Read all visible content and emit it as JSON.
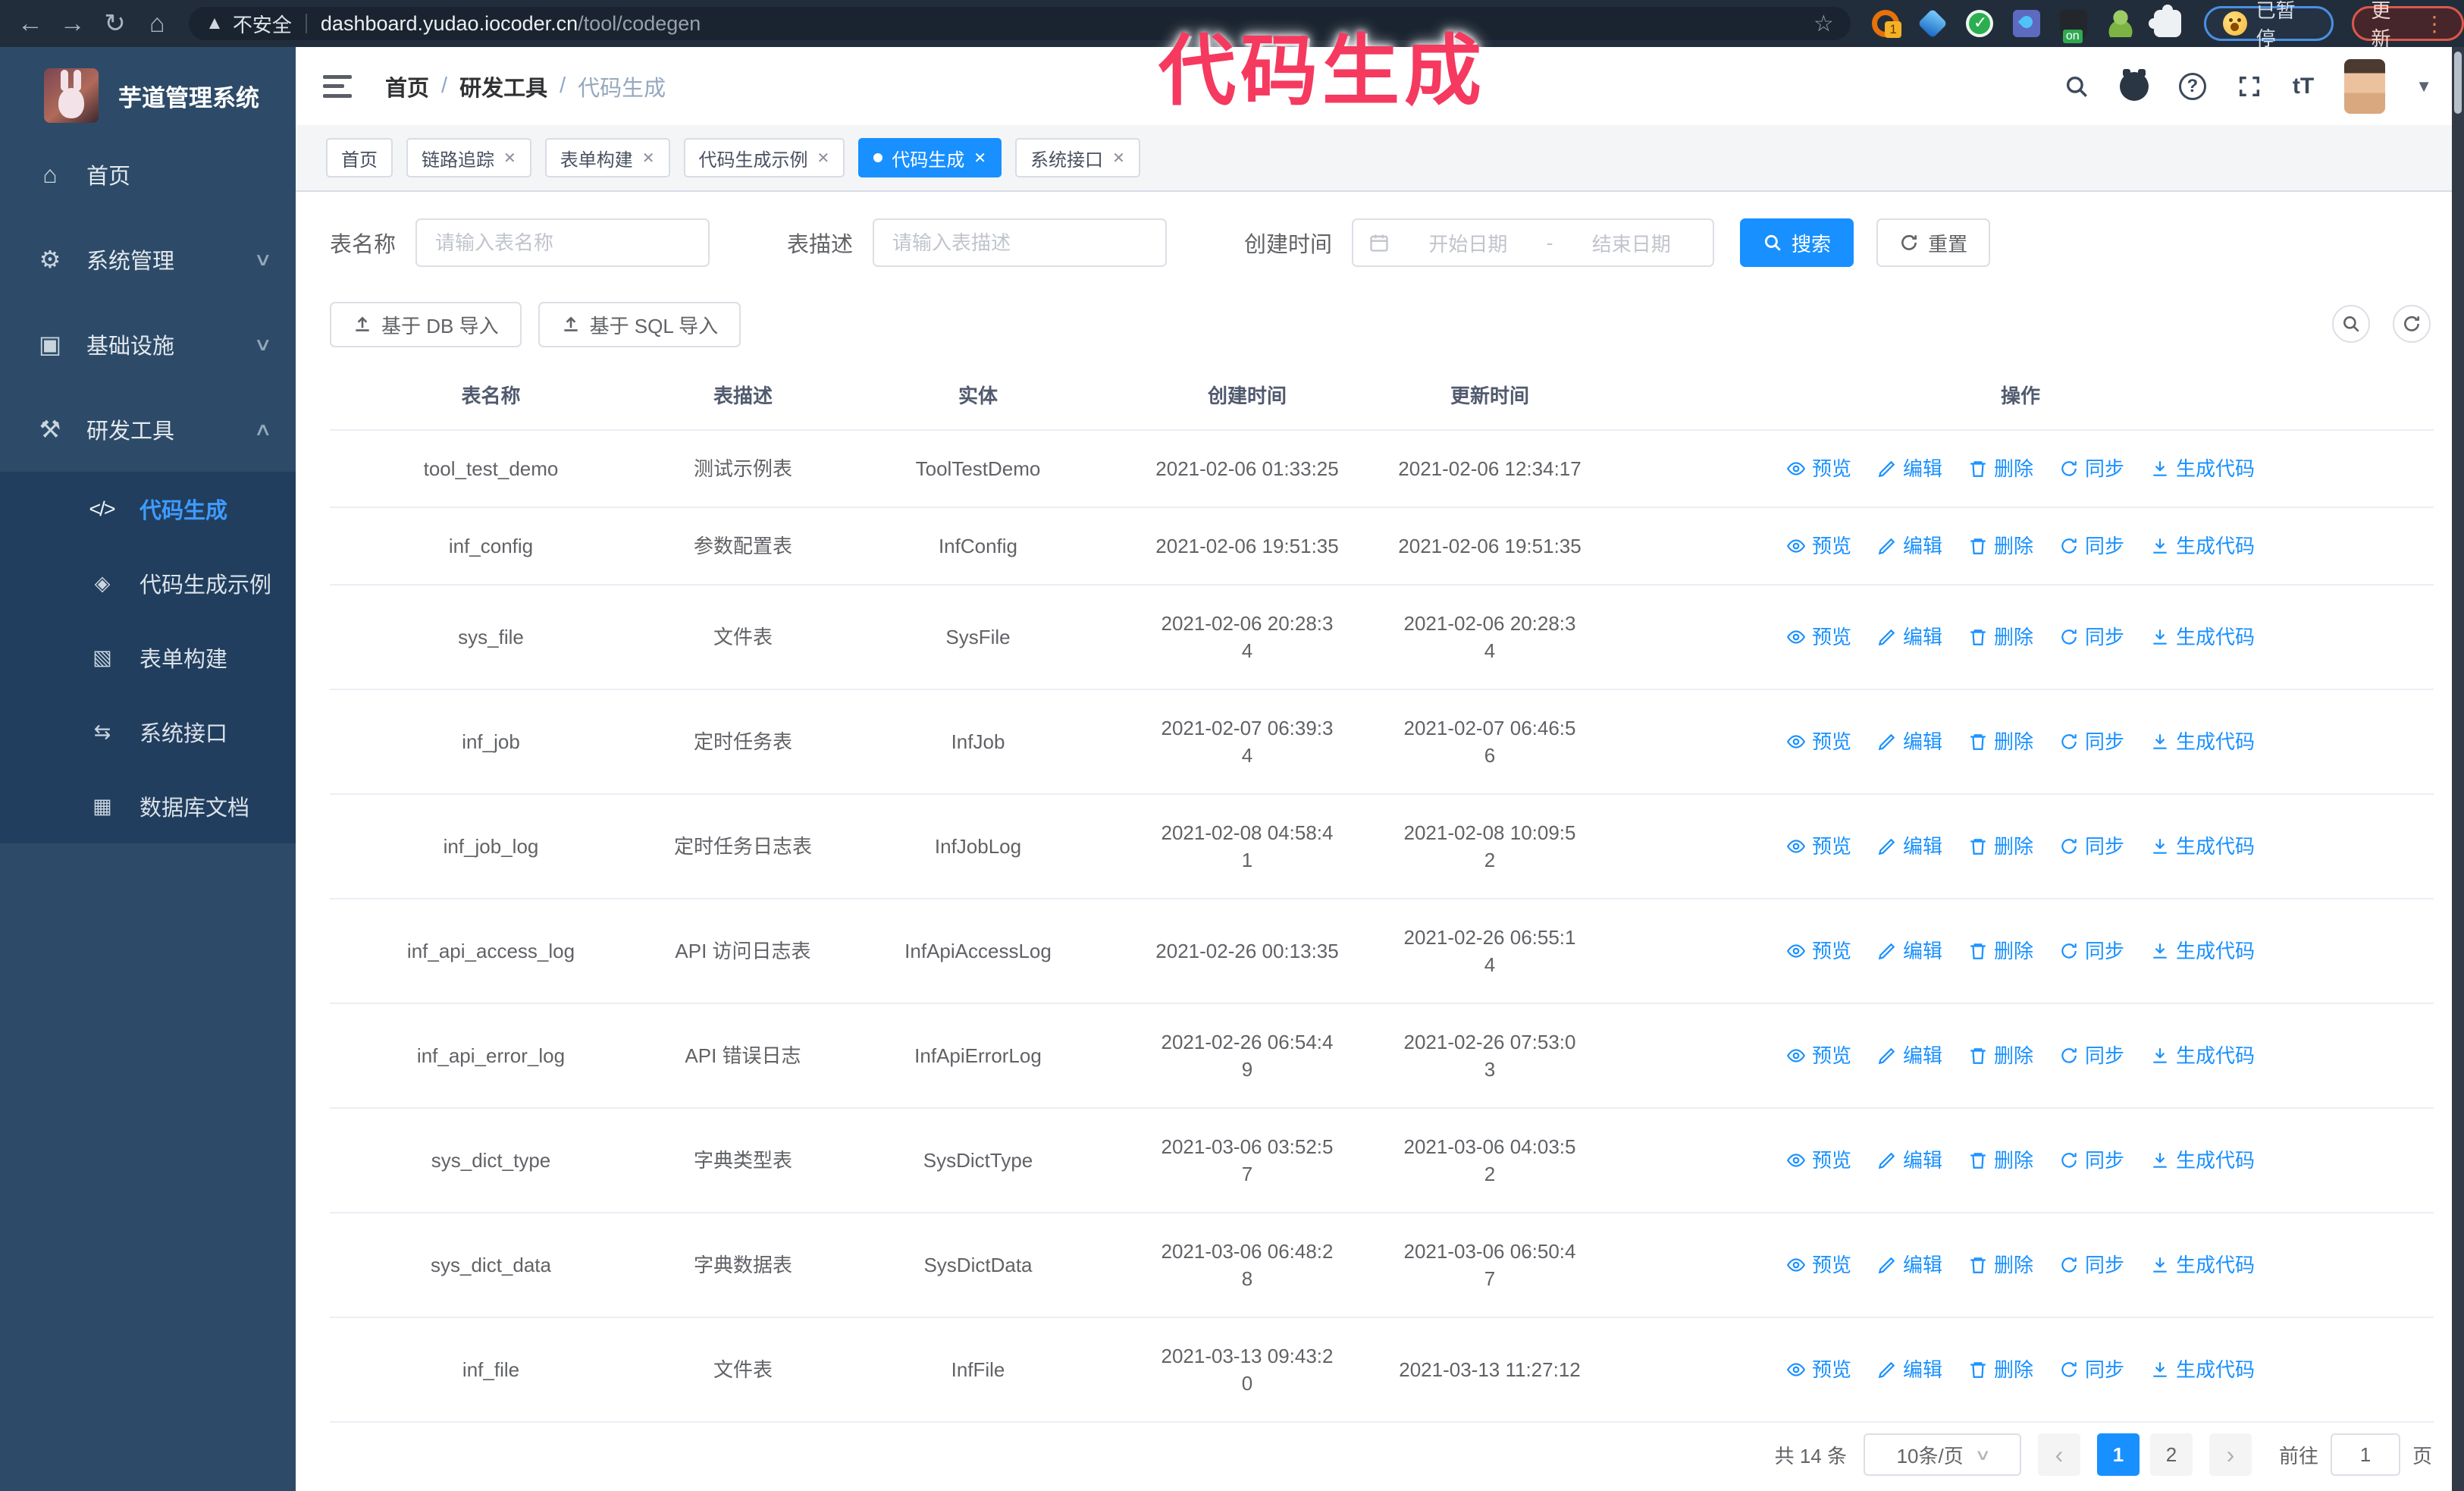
{
  "colors": {
    "accent": "#1890ff",
    "active-link": "#3f9bff",
    "annotation": "#f5395f",
    "topbar-bg": "#222d3b",
    "sidebar-bg": "#2d4b68",
    "submenu-bg": "#213e5e"
  },
  "annotation": {
    "text": "代码生成"
  },
  "browser": {
    "insecure_label": "不安全",
    "url_host": "dashboard.yudao.iocoder.cn",
    "url_path": "/tool/codegen",
    "paused_badge": "已暂停",
    "update_badge": "更新",
    "extensions": [
      "refresh-orange-icon",
      "gem-icon",
      "check-shield-icon",
      "tabs-droplet-icon",
      "recorder-on-icon",
      "person-icon",
      "puzzle-icon"
    ]
  },
  "sidebar": {
    "app_title": "芋道管理系统",
    "items": [
      {
        "label": "首页",
        "icon": "home-icon",
        "chevron": ""
      },
      {
        "label": "系统管理",
        "icon": "gear-icon",
        "chevron": "down"
      },
      {
        "label": "基础设施",
        "icon": "infra-icon",
        "chevron": "down"
      },
      {
        "label": "研发工具",
        "icon": "toolbox-icon",
        "chevron": "up"
      }
    ],
    "submenu": [
      {
        "label": "代码生成",
        "icon": "code-icon",
        "active": true
      },
      {
        "label": "代码生成示例",
        "icon": "example-icon",
        "active": false
      },
      {
        "label": "表单构建",
        "icon": "form-icon",
        "active": false
      },
      {
        "label": "系统接口",
        "icon": "api-icon",
        "active": false
      },
      {
        "label": "数据库文档",
        "icon": "dbdoc-icon",
        "active": false
      }
    ]
  },
  "header": {
    "breadcrumb": [
      "首页",
      "研发工具",
      "代码生成"
    ]
  },
  "tabs": [
    {
      "label": "首页",
      "closable": false,
      "active": false
    },
    {
      "label": "链路追踪",
      "closable": true,
      "active": false
    },
    {
      "label": "表单构建",
      "closable": true,
      "active": false
    },
    {
      "label": "代码生成示例",
      "closable": true,
      "active": false
    },
    {
      "label": "代码生成",
      "closable": true,
      "active": true
    },
    {
      "label": "系统接口",
      "closable": true,
      "active": false
    }
  ],
  "filters": {
    "name_label": "表名称",
    "name_placeholder": "请输入表名称",
    "desc_label": "表描述",
    "desc_placeholder": "请输入表描述",
    "time_label": "创建时间",
    "start_placeholder": "开始日期",
    "range_separator": "-",
    "end_placeholder": "结束日期",
    "search_label": "搜索",
    "reset_label": "重置",
    "import_db_label": "基于 DB 导入",
    "import_sql_label": "基于 SQL 导入"
  },
  "table": {
    "columns": [
      "表名称",
      "表描述",
      "实体",
      "创建时间",
      "更新时间",
      "操作"
    ],
    "actions": [
      "预览",
      "编辑",
      "删除",
      "同步",
      "生成代码"
    ],
    "rows": [
      {
        "name": "tool_test_demo",
        "desc": "测试示例表",
        "entity": "ToolTestDemo",
        "created": "2021-02-06 01:33:25",
        "updated": "2021-02-06 12:34:17"
      },
      {
        "name": "inf_config",
        "desc": "参数配置表",
        "entity": "InfConfig",
        "created": "2021-02-06 19:51:35",
        "updated": "2021-02-06 19:51:35"
      },
      {
        "name": "sys_file",
        "desc": "文件表",
        "entity": "SysFile",
        "created": "2021-02-06 20:28:3\n4",
        "updated": "2021-02-06 20:28:3\n4"
      },
      {
        "name": "inf_job",
        "desc": "定时任务表",
        "entity": "InfJob",
        "created": "2021-02-07 06:39:3\n4",
        "updated": "2021-02-07 06:46:5\n6"
      },
      {
        "name": "inf_job_log",
        "desc": "定时任务日志表",
        "entity": "InfJobLog",
        "created": "2021-02-08 04:58:4\n1",
        "updated": "2021-02-08 10:09:5\n2"
      },
      {
        "name": "inf_api_access_log",
        "desc": "API 访问日志表",
        "entity": "InfApiAccessLog",
        "created": "2021-02-26 00:13:35",
        "updated": "2021-02-26 06:55:1\n4"
      },
      {
        "name": "inf_api_error_log",
        "desc": "API 错误日志",
        "entity": "InfApiErrorLog",
        "created": "2021-02-26 06:54:4\n9",
        "updated": "2021-02-26 07:53:0\n3"
      },
      {
        "name": "sys_dict_type",
        "desc": "字典类型表",
        "entity": "SysDictType",
        "created": "2021-03-06 03:52:5\n7",
        "updated": "2021-03-06 04:03:5\n2"
      },
      {
        "name": "sys_dict_data",
        "desc": "字典数据表",
        "entity": "SysDictData",
        "created": "2021-03-06 06:48:2\n8",
        "updated": "2021-03-06 06:50:4\n7"
      },
      {
        "name": "inf_file",
        "desc": "文件表",
        "entity": "InfFile",
        "created": "2021-03-13 09:43:2\n0",
        "updated": "2021-03-13 11:27:12"
      }
    ]
  },
  "pagination": {
    "total": "共 14 条",
    "page_size": "10条/页",
    "pages": [
      "1",
      "2"
    ],
    "active_page": "1",
    "goto_label": "前往",
    "goto_value": "1",
    "page_unit": "页"
  }
}
